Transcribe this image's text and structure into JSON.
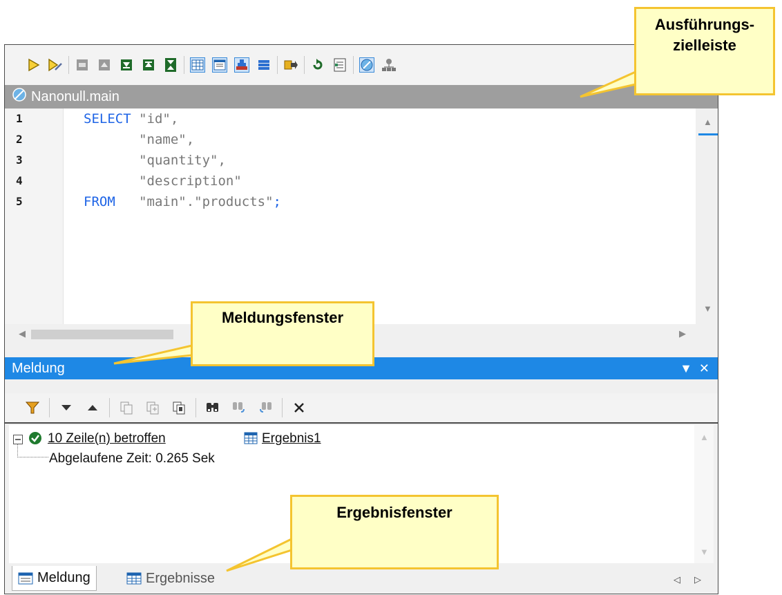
{
  "toolbar": {
    "buttons": [
      "run-icon",
      "run-tuned-icon",
      "sep",
      "collapse-all-icon",
      "expand-up-icon",
      "expand-icon",
      "minimize-icon",
      "maximize-icon",
      "sep",
      "grid-view-icon",
      "text-view-icon",
      "pyramid-icon",
      "list-view-icon",
      "sep",
      "export-icon",
      "sep",
      "refresh-icon",
      "properties-icon",
      "sep",
      "execution-target-icon",
      "network-icon"
    ]
  },
  "target_bar": {
    "label": "Nanonull.main"
  },
  "editor": {
    "line_numbers": [
      "1",
      "2",
      "3",
      "4",
      "5"
    ],
    "lines": [
      {
        "kw": "SELECT ",
        "str": "\"id\",",
        "tail": ""
      },
      {
        "kw": "       ",
        "str": "\"name\",",
        "tail": ""
      },
      {
        "kw": "       ",
        "str": "\"quantity\",",
        "tail": ""
      },
      {
        "kw": "       ",
        "str": "\"description\"",
        "tail": ""
      },
      {
        "kw": "FROM   ",
        "str": "\"main\".\"products\"",
        "tail": ";"
      }
    ]
  },
  "message_panel": {
    "title": "Meldung",
    "rows_affected": "10 Zeile(n) betroffen",
    "result_link": "Ergebnis1",
    "elapsed": "Abgelaufene Zeit: 0.265 Sek"
  },
  "tabs": {
    "messages": "Meldung",
    "results": "Ergebnisse"
  },
  "callouts": {
    "execution_target_line1": "Ausführungs-",
    "execution_target_line2": "zielleiste",
    "message_window": "Meldungsfenster",
    "results_window": "Ergebnisfenster"
  },
  "colors": {
    "accent": "#1e88e5",
    "callout_bg": "#ffffc6",
    "callout_border": "#f4c430",
    "keyword": "#1e64e6",
    "string": "#777777"
  }
}
